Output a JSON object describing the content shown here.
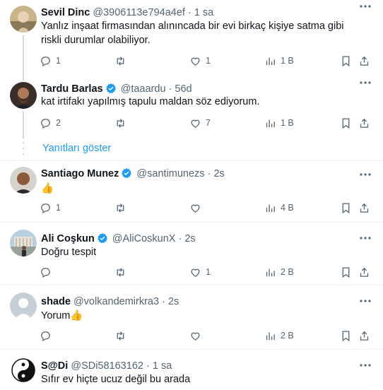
{
  "tweets": [
    {
      "name": "Sevil Dinc",
      "handle": "@3906113e794a4ef",
      "time": "1 sa",
      "verified": false,
      "text": "Yanlız inşaat firmasından alınıncada bir evi birkaç kişiye satma gibi riskli durumlar olabiliyor.",
      "replies": "1",
      "retweets": "",
      "likes": "1",
      "views": "1 B"
    },
    {
      "name": "Tardu Barlas",
      "handle": "@taaardu",
      "time": "56d",
      "verified": true,
      "text": "kat irtifakı yapılmış tapulu maldan söz ediyorum.",
      "replies": "2",
      "retweets": "",
      "likes": "7",
      "views": "1 B"
    },
    {
      "name": "Santiago Munez",
      "handle": "@santimunezs",
      "time": "2s",
      "verified": true,
      "text": "👍",
      "replies": "1",
      "retweets": "",
      "likes": "",
      "views": "4 B"
    },
    {
      "name": "Ali Coşkun",
      "handle": "@AliCoskunX",
      "time": "2s",
      "verified": true,
      "text": "Doğru tespit",
      "replies": "",
      "retweets": "",
      "likes": "1",
      "views": "2 B"
    },
    {
      "name": "shade",
      "handle": "@volkandemirkra3",
      "time": "2s",
      "verified": false,
      "text": "Yorum👍",
      "replies": "",
      "retweets": "",
      "likes": "",
      "views": "2 B"
    },
    {
      "name": "S@Di",
      "handle": "@SDi58163162",
      "time": "1 sa",
      "verified": false,
      "text": "Sıfır ev hiçte ucuz değil bu arada",
      "replies": "",
      "retweets": "",
      "likes": "",
      "views": ""
    }
  ],
  "show_replies_label": "Yanıtları göster",
  "separator": "·",
  "colors": {
    "accent": "#1d9bf0",
    "secondary_text": "#536471",
    "verified": "#1d9bf0"
  }
}
